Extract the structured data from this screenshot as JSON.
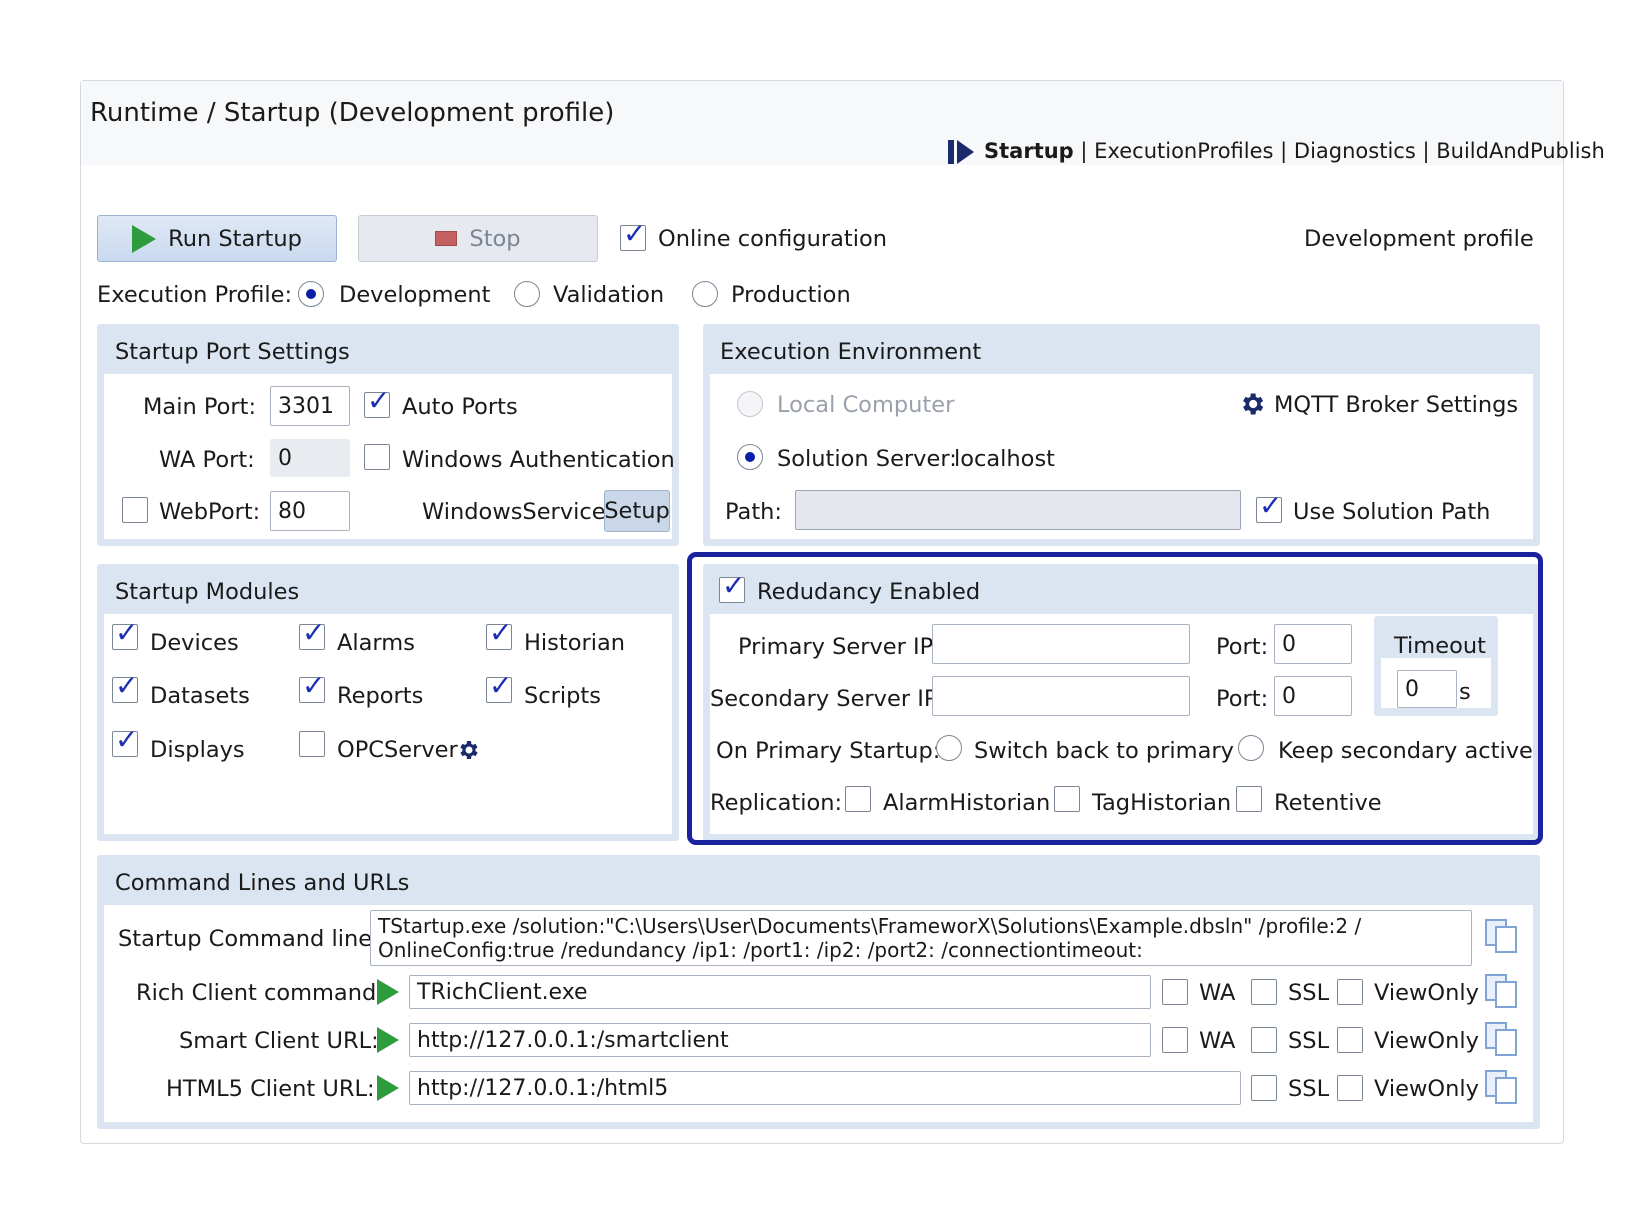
{
  "header": {
    "title": "Runtime / Startup (Development profile)",
    "nav": {
      "current": "Startup",
      "links": [
        "ExecutionProfiles",
        "Diagnostics",
        "BuildAndPublish"
      ],
      "separator": "|"
    }
  },
  "toolbar": {
    "run_label": "Run Startup",
    "stop_label": "Stop",
    "online_config_label": "Online configuration",
    "online_config_checked": true,
    "profile_status": "Development profile"
  },
  "execution_profile": {
    "label": "Execution Profile:",
    "options": [
      "Development",
      "Validation",
      "Production"
    ],
    "selected": "Development"
  },
  "port_settings": {
    "title": "Startup Port Settings",
    "main_port_label": "Main Port:",
    "main_port_value": "3301",
    "auto_ports_label": "Auto Ports",
    "auto_ports_checked": true,
    "wa_port_label": "WA Port:",
    "wa_port_value": "0",
    "windows_auth_label": "Windows Authentication",
    "windows_auth_checked": false,
    "webport_label": "WebPort:",
    "webport_checked": false,
    "webport_value": "80",
    "windows_service_label": "WindowsService",
    "setup_label": "Setup"
  },
  "execution_environment": {
    "title": "Execution Environment",
    "local_computer_label": "Local Computer",
    "mqtt_label": "MQTT Broker Settings",
    "solution_server_label": "Solution Server:",
    "solution_server_value": "localhost",
    "path_label": "Path:",
    "path_value": "",
    "use_solution_path_label": "Use Solution Path",
    "use_solution_path_checked": true
  },
  "startup_modules": {
    "title": "Startup Modules",
    "modules": [
      {
        "label": "Devices",
        "checked": true
      },
      {
        "label": "Alarms",
        "checked": true
      },
      {
        "label": "Historian",
        "checked": true
      },
      {
        "label": "Datasets",
        "checked": true
      },
      {
        "label": "Reports",
        "checked": true
      },
      {
        "label": "Scripts",
        "checked": true
      },
      {
        "label": "Displays",
        "checked": true
      },
      {
        "label": "OPCServer",
        "checked": false
      }
    ]
  },
  "redundancy": {
    "enabled_label": "Redudancy Enabled",
    "enabled_checked": true,
    "primary_ip_label": "Primary Server IP:",
    "primary_ip_value": "",
    "secondary_ip_label": "Secondary Server IP:",
    "secondary_ip_value": "",
    "port_label": "Port:",
    "primary_port_value": "0",
    "secondary_port_value": "0",
    "timeout_label": "Timeout",
    "timeout_value": "0",
    "timeout_unit": "s",
    "on_primary_startup_label": "On Primary Startup:",
    "switch_back_label": "Switch back to primary",
    "keep_secondary_label": "Keep secondary active",
    "replication_label": "Replication:",
    "replication": [
      {
        "label": "AlarmHistorian",
        "checked": false
      },
      {
        "label": "TagHistorian",
        "checked": false
      },
      {
        "label": "Retentive",
        "checked": false
      }
    ]
  },
  "command_lines": {
    "title": "Command Lines and URLs",
    "startup_label": "Startup Command line:",
    "startup_line1": "TStartup.exe /solution:\"C:\\Users\\User\\Documents\\FrameworX\\Solutions\\Example.dbsln\" /profile:2 /",
    "startup_line2": "OnlineConfig:true /redundancy /ip1: /port1: /ip2: /port2: /connectiontimeout:",
    "rich_label": "Rich Client command:",
    "rich_value": "TRichClient.exe",
    "smart_label": "Smart Client URL:",
    "smart_value": "http://127.0.0.1:/smartclient",
    "html5_label": "HTML5 Client URL:",
    "html5_value": "http://127.0.0.1:/html5",
    "wa_label": "WA",
    "ssl_label": "SSL",
    "viewonly_label": "ViewOnly"
  },
  "colors": {
    "accent_border": "#1b22a0",
    "panel_header": "#dbe5f1",
    "check_mark": "#1c2fb4",
    "run_icon": "#2e9b3c"
  },
  "icons": [
    "startup-nav-icon",
    "play-icon",
    "stop-icon",
    "gear-icon",
    "copy-icon"
  ]
}
